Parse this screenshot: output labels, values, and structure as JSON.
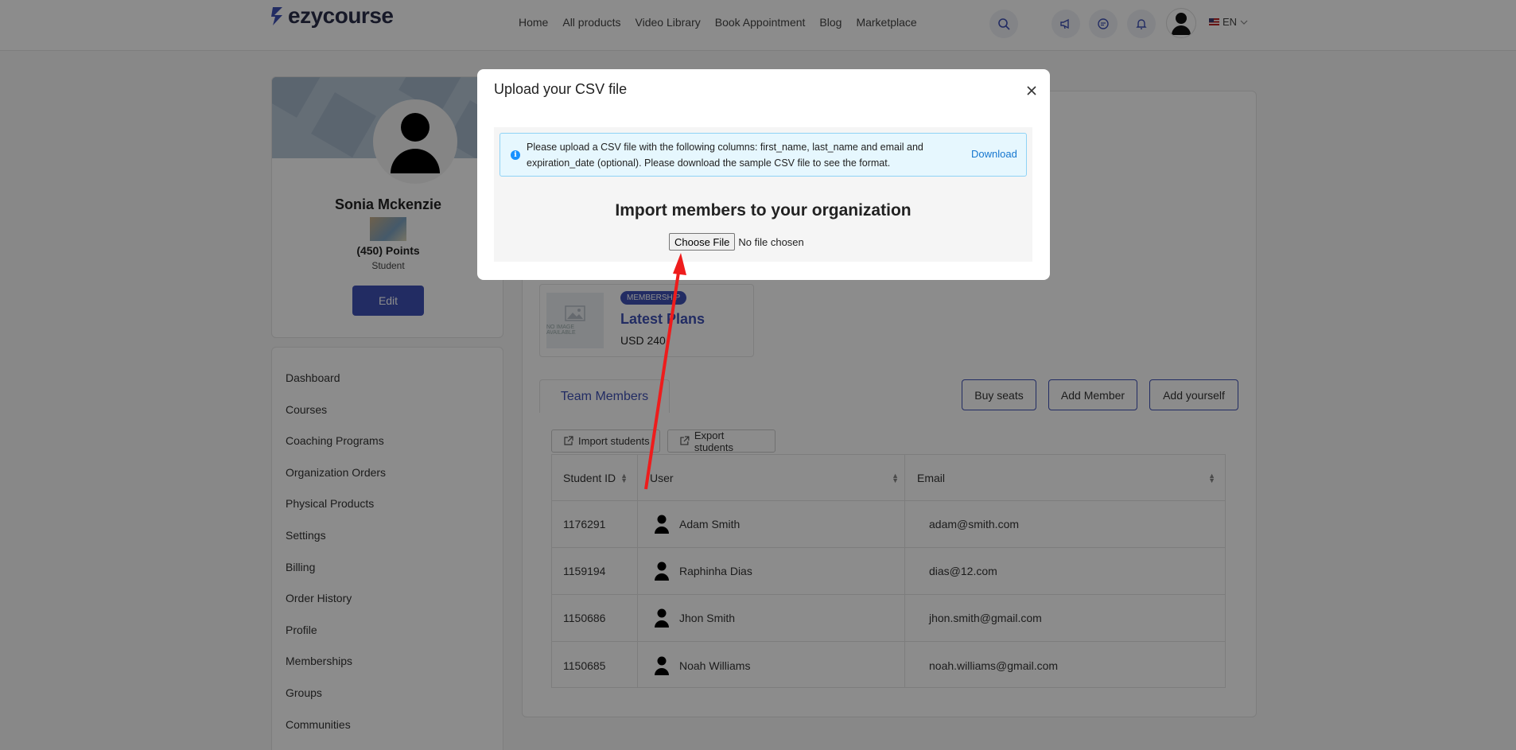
{
  "header": {
    "logo_text": "ezycourse",
    "nav": [
      "Home",
      "All products",
      "Video Library",
      "Book Appointment",
      "Blog",
      "Marketplace"
    ],
    "language": "EN"
  },
  "profile": {
    "name": "Sonia Mckenzie",
    "points": "(450) Points",
    "role": "Student",
    "edit_label": "Edit"
  },
  "sidebar": {
    "items": [
      "Dashboard",
      "Courses",
      "Coaching Programs",
      "Organization Orders",
      "Physical Products",
      "Settings",
      "Billing",
      "Order History",
      "Profile",
      "Memberships",
      "Groups",
      "Communities"
    ]
  },
  "plan": {
    "badge": "MEMBERSHIP",
    "title": "Latest Plans",
    "price": "USD 240",
    "no_image_text": "NO IMAGE AVAILABLE"
  },
  "team": {
    "tab_label": "Team Members",
    "buy_seats": "Buy seats",
    "add_member": "Add Member",
    "add_yourself": "Add yourself",
    "import_students": "Import students",
    "export_students": "Export students"
  },
  "table": {
    "headers": [
      "Student ID",
      "User",
      "Email"
    ],
    "rows": [
      {
        "id": "1176291",
        "user": "Adam Smith",
        "email": "adam@smith.com"
      },
      {
        "id": "1159194",
        "user": "Raphinha Dias",
        "email": "dias@12.com"
      },
      {
        "id": "1150686",
        "user": "Jhon Smith",
        "email": "jhon.smith@gmail.com"
      },
      {
        "id": "1150685",
        "user": "Noah Williams",
        "email": "noah.williams@gmail.com"
      }
    ]
  },
  "modal": {
    "title": "Upload your CSV file",
    "alert_text": "Please upload a CSV file with the following columns: first_name, last_name and email and expiration_date (optional). Please download the sample CSV file to see the format.",
    "download_label": "Download",
    "import_heading": "Import members to your organization",
    "choose_file_label": "Choose File",
    "no_file_text": "No file chosen"
  },
  "colors": {
    "accent": "#3f51b5",
    "overlay": "rgba(0,0,0,0.45)",
    "annotation_arrow": "#ee1c1c"
  }
}
